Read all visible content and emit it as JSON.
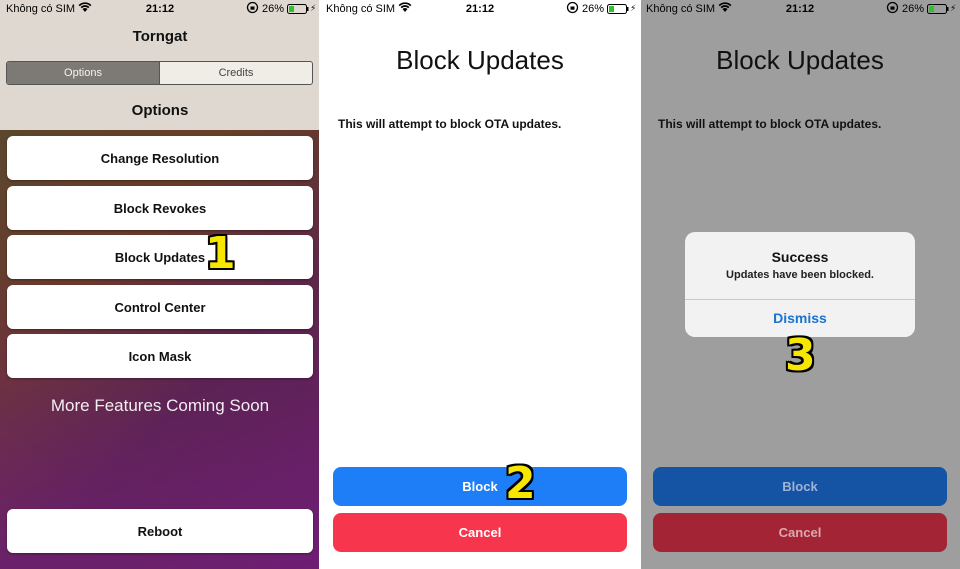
{
  "status_bar": {
    "carrier": "Không có SIM",
    "time": "21:12",
    "battery_pct": "26%"
  },
  "panel1": {
    "app_title": "Torngat",
    "segments": [
      {
        "label": "Options",
        "active": true
      },
      {
        "label": "Credits",
        "active": false
      }
    ],
    "section_title": "Options",
    "options": [
      "Change Resolution",
      "Block Revokes",
      "Block Updates",
      "Control Center",
      "Icon Mask"
    ],
    "coming_soon": "More Features Coming Soon",
    "reboot_label": "Reboot",
    "step_number": "1"
  },
  "panel2": {
    "title": "Block Updates",
    "description": "This will attempt to block OTA updates.",
    "block_label": "Block",
    "cancel_label": "Cancel",
    "step_number": "2"
  },
  "panel3": {
    "title": "Block Updates",
    "description": "This will attempt to block OTA updates.",
    "block_label": "Block",
    "cancel_label": "Cancel",
    "alert": {
      "title": "Success",
      "message": "Updates have been blocked.",
      "button": "Dismiss"
    },
    "step_number": "3"
  },
  "colors": {
    "ios_blue": "#1e7ef8",
    "ios_red": "#f7364d",
    "step_yellow": "#f7e600",
    "dismiss_blue": "#1a73d0"
  },
  "icons": [
    "wifi-icon",
    "orientation-lock-icon",
    "battery-icon",
    "charging-bolt-icon"
  ]
}
